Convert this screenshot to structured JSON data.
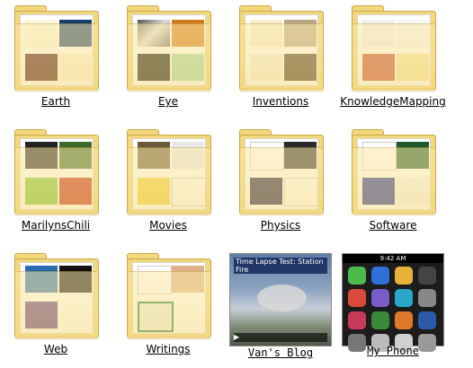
{
  "items": [
    {
      "label": "Earth"
    },
    {
      "label": "Eye"
    },
    {
      "label": "Inventions"
    },
    {
      "label": "KnowledgeMapping"
    },
    {
      "label": "MarilynsChili"
    },
    {
      "label": "Movies"
    },
    {
      "label": "Physics"
    },
    {
      "label": "Software"
    },
    {
      "label": "Web"
    },
    {
      "label": "Writings"
    },
    {
      "label": "Van's Blog"
    },
    {
      "label": "My Phone"
    }
  ],
  "blog_thumb": {
    "title": "Time Lapse Test: Station Fire",
    "play_label": "▶"
  },
  "phone_thumb": {
    "clock": "9:42 AM"
  },
  "colors": {
    "folder": "#f3d77c",
    "folder_edge": "#c9a94a",
    "phone_apps": [
      "#4cbb4c",
      "#2f6fd8",
      "#e8b23a",
      "#444444",
      "#d94a3a",
      "#7a5cc8",
      "#2aa7c8",
      "#888888",
      "#c83a5a",
      "#3a8a3a",
      "#e07a2a",
      "#2a5aa8",
      "#777777",
      "#bbbbbb",
      "#d0d0d0",
      "#999999"
    ]
  }
}
